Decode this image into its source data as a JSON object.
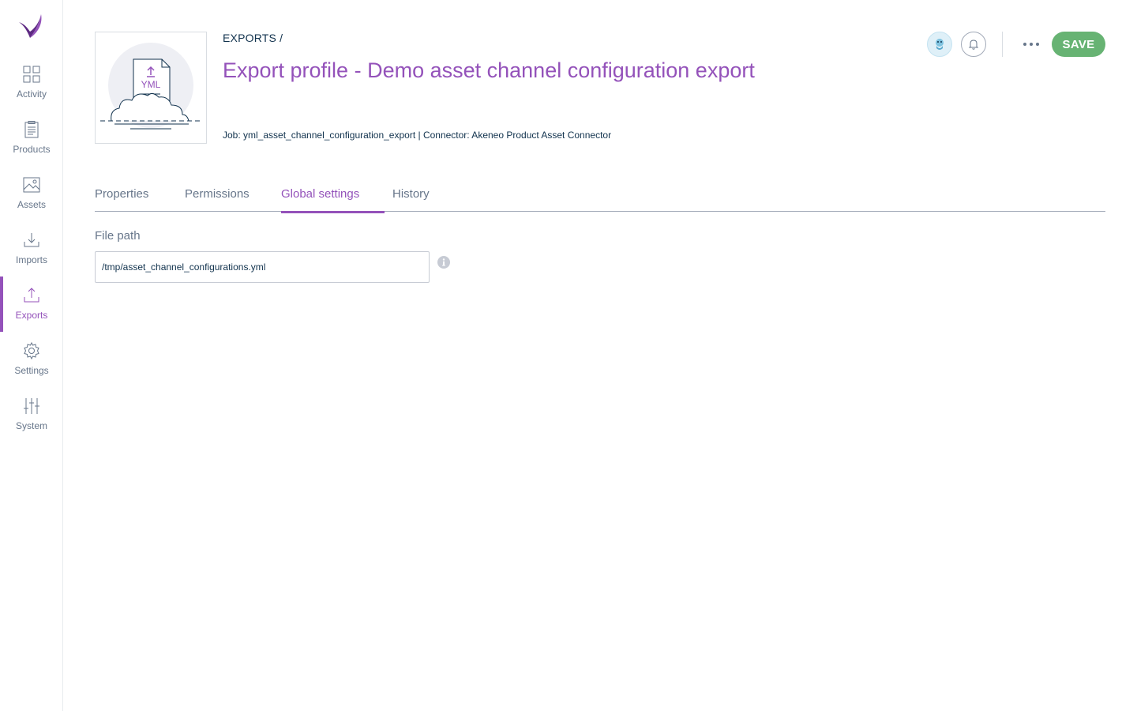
{
  "sidebar": {
    "items": [
      {
        "label": "Activity",
        "icon": "activity-icon"
      },
      {
        "label": "Products",
        "icon": "products-icon"
      },
      {
        "label": "Assets",
        "icon": "assets-icon"
      },
      {
        "label": "Imports",
        "icon": "imports-icon"
      },
      {
        "label": "Exports",
        "icon": "exports-icon",
        "active": true
      },
      {
        "label": "Settings",
        "icon": "settings-icon"
      },
      {
        "label": "System",
        "icon": "system-icon"
      }
    ]
  },
  "header": {
    "thumbnail_text": "YML",
    "breadcrumb": "EXPORTS /",
    "title": "Export profile - Demo asset channel configuration export",
    "meta": "Job: yml_asset_channel_configuration_export | Connector: Akeneo Product Asset Connector",
    "save_label": "SAVE"
  },
  "tabs": [
    {
      "label": "Properties"
    },
    {
      "label": "Permissions"
    },
    {
      "label": "Global settings",
      "active": true
    },
    {
      "label": "History"
    }
  ],
  "form": {
    "file_path_label": "File path",
    "file_path_value": "/tmp/asset_channel_configurations.yml"
  },
  "colors": {
    "accent": "#9452ba",
    "save": "#67b373",
    "text": "#67768a",
    "dark_text": "#11324d"
  }
}
